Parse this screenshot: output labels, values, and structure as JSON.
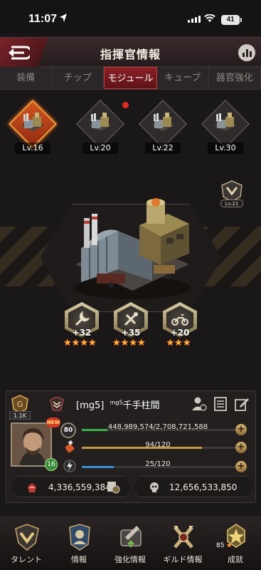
{
  "status_bar": {
    "time": "11:07",
    "battery": "41"
  },
  "header": {
    "title": "指揮官情報",
    "back_icon": "back-arrow-icon",
    "stats_icon": "bar-chart-icon"
  },
  "tabs": [
    {
      "label": "装備",
      "active": false
    },
    {
      "label": "チップ",
      "active": false
    },
    {
      "label": "モジュール",
      "active": true
    },
    {
      "label": "キューブ",
      "active": false
    },
    {
      "label": "器官強化",
      "active": false
    }
  ],
  "modules": [
    {
      "level": "Lv.16",
      "selected": true
    },
    {
      "level": "Lv.20",
      "selected": false
    },
    {
      "level": "Lv.22",
      "selected": false
    },
    {
      "level": "Lv.30",
      "selected": false
    }
  ],
  "side_badge": {
    "level": "Lv.21"
  },
  "skills": [
    {
      "bonus": "+32",
      "stars": 4,
      "icon": "wrench-icon"
    },
    {
      "bonus": "+35",
      "stars": 4,
      "icon": "tools-icon"
    },
    {
      "bonus": "+20",
      "stars": 3,
      "icon": "motorcycle-icon"
    }
  ],
  "profile": {
    "fans": "1.1K",
    "name_prefix": "[mg5]",
    "name_sup": "mg5",
    "name": "千手柱間",
    "new_badge": "NEW",
    "avatar_level": "16",
    "level": "80",
    "exp": {
      "text": "448,989,574/2,708,721,588",
      "ratio": 0.166,
      "color": "#37b24a"
    },
    "stamina": {
      "text": "94/120",
      "ratio": 0.783,
      "color": "#c79a3e"
    },
    "energy": {
      "text": "25/120",
      "ratio": 0.208,
      "color": "#3b8ed6"
    },
    "power": "4,336,559,384",
    "kills": "12,656,533,850"
  },
  "nav": [
    {
      "label": "タレント",
      "icon": "talent-icon"
    },
    {
      "label": "情報",
      "icon": "info-icon"
    },
    {
      "label": "強化情報",
      "icon": "upgrade-icon"
    },
    {
      "label": "ギルド情報",
      "icon": "guild-icon"
    },
    {
      "label": "成就",
      "icon": "achievement-icon"
    }
  ],
  "achievement_points": "85"
}
